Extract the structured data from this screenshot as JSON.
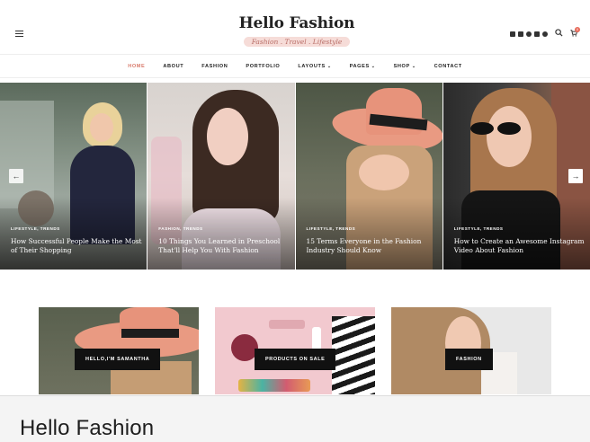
{
  "header": {
    "logo_title": "Hello Fashion",
    "logo_tagline": "Fashion . Travel . Lifestyle",
    "social_icons": [
      "facebook-icon",
      "vimeo-icon",
      "instagram-icon",
      "youtube-icon",
      "pinterest-icon"
    ],
    "cart_count": "0"
  },
  "nav": {
    "items": [
      {
        "label": "HOME",
        "active": true
      },
      {
        "label": "ABOUT"
      },
      {
        "label": "FASHION"
      },
      {
        "label": "PORTFOLIO"
      },
      {
        "label": "LAYOUTS",
        "dropdown": true
      },
      {
        "label": "PAGES",
        "dropdown": true
      },
      {
        "label": "SHOP",
        "dropdown": true
      },
      {
        "label": "CONTACT"
      }
    ]
  },
  "slider": {
    "slides": [
      {
        "category": "LIFESTYLE, TRENDS",
        "title": "How Successful People Make the Most of Their Shopping"
      },
      {
        "category": "FASHION, TRENDS",
        "title": "10 Things You Learned in Preschool That'll Help You With Fashion"
      },
      {
        "category": "LIFESTYLE, TRENDS",
        "title": "15 Terms Everyone in the Fashion Industry Should Know"
      },
      {
        "category": "LIFESTYLE, TRENDS",
        "title": "How to Create an Awesome Instagram Video About Fashion"
      }
    ],
    "prev_arrow": "←",
    "next_arrow": "→"
  },
  "promos": [
    {
      "label": "HELLO,I'M SAMANTHA"
    },
    {
      "label": "PRODUCTS ON SALE"
    },
    {
      "label": "FASHION"
    }
  ],
  "footer_bar": {
    "title": "Hello Fashion"
  },
  "colors": {
    "accent": "#d97b6c",
    "tagline_bg": "#f6dcd8",
    "label_bg": "#111111"
  }
}
